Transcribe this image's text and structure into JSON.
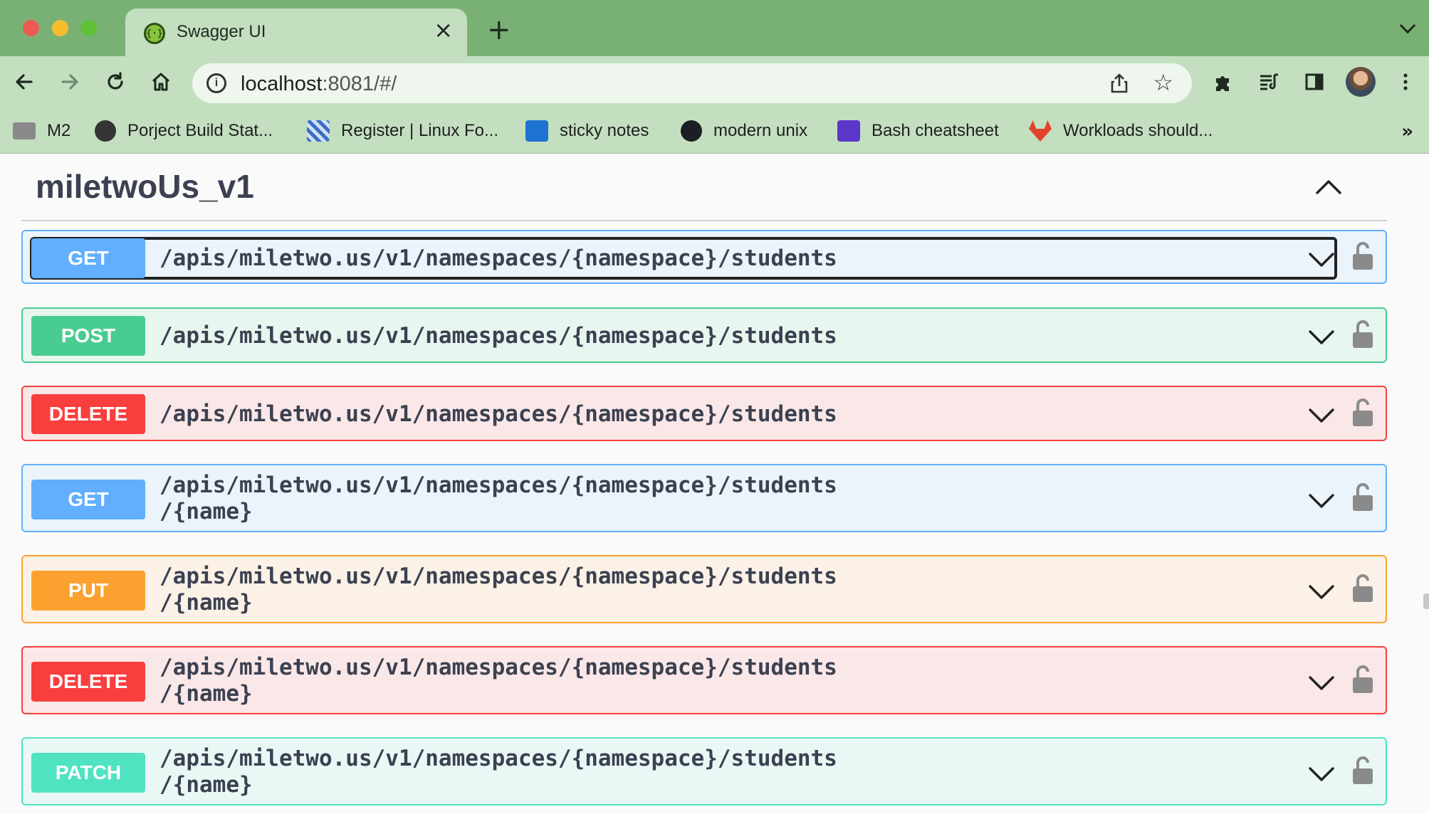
{
  "browser": {
    "tab_title": "Swagger UI",
    "url_host": "localhost",
    "url_rest": ":8081/#/",
    "bookmarks": [
      {
        "label": "M2",
        "icon": "folder-icon",
        "color": "#8a8a8a"
      },
      {
        "label": "Porject Build Stat...",
        "icon": "circle-ci-icon",
        "color": "#343434"
      },
      {
        "label": "Register | Linux Fo...",
        "icon": "linux-foundation-icon",
        "color": "#3b6ec4"
      },
      {
        "label": "sticky notes",
        "icon": "outlook-icon",
        "color": "#1e73d0"
      },
      {
        "label": "modern unix",
        "icon": "github-icon",
        "color": "#1b1f23"
      },
      {
        "label": "Bash cheatsheet",
        "icon": "clip-icon",
        "color": "#5b37c9"
      },
      {
        "label": "Workloads should...",
        "icon": "gitlab-icon",
        "color": "#e2432a"
      }
    ]
  },
  "swagger": {
    "tag_title": "miletwoUs_v1",
    "operations": [
      {
        "method": "GET",
        "path": "/apis/miletwo.us/v1/namespaces/{namespace}/students",
        "kind": "get",
        "focused": true
      },
      {
        "method": "POST",
        "path": "/apis/miletwo.us/v1/namespaces/{namespace}/students",
        "kind": "post"
      },
      {
        "method": "DELETE",
        "path": "/apis/miletwo.us/v1/namespaces/{namespace}/students",
        "kind": "delete"
      },
      {
        "method": "GET",
        "path": "/apis/miletwo.us/v1/namespaces/{namespace}/students\n/{name}",
        "kind": "get"
      },
      {
        "method": "PUT",
        "path": "/apis/miletwo.us/v1/namespaces/{namespace}/students\n/{name}",
        "kind": "put"
      },
      {
        "method": "DELETE",
        "path": "/apis/miletwo.us/v1/namespaces/{namespace}/students\n/{name}",
        "kind": "delete"
      },
      {
        "method": "PATCH",
        "path": "/apis/miletwo.us/v1/namespaces/{namespace}/students\n/{name}",
        "kind": "patch"
      }
    ]
  },
  "colors": {
    "get": "#61affe",
    "post": "#49cc90",
    "delete": "#f93e3e",
    "put": "#fca130",
    "patch": "#50e3c2",
    "chrome_frame": "#79b174",
    "chrome_toolbar": "#c3dfc0"
  }
}
